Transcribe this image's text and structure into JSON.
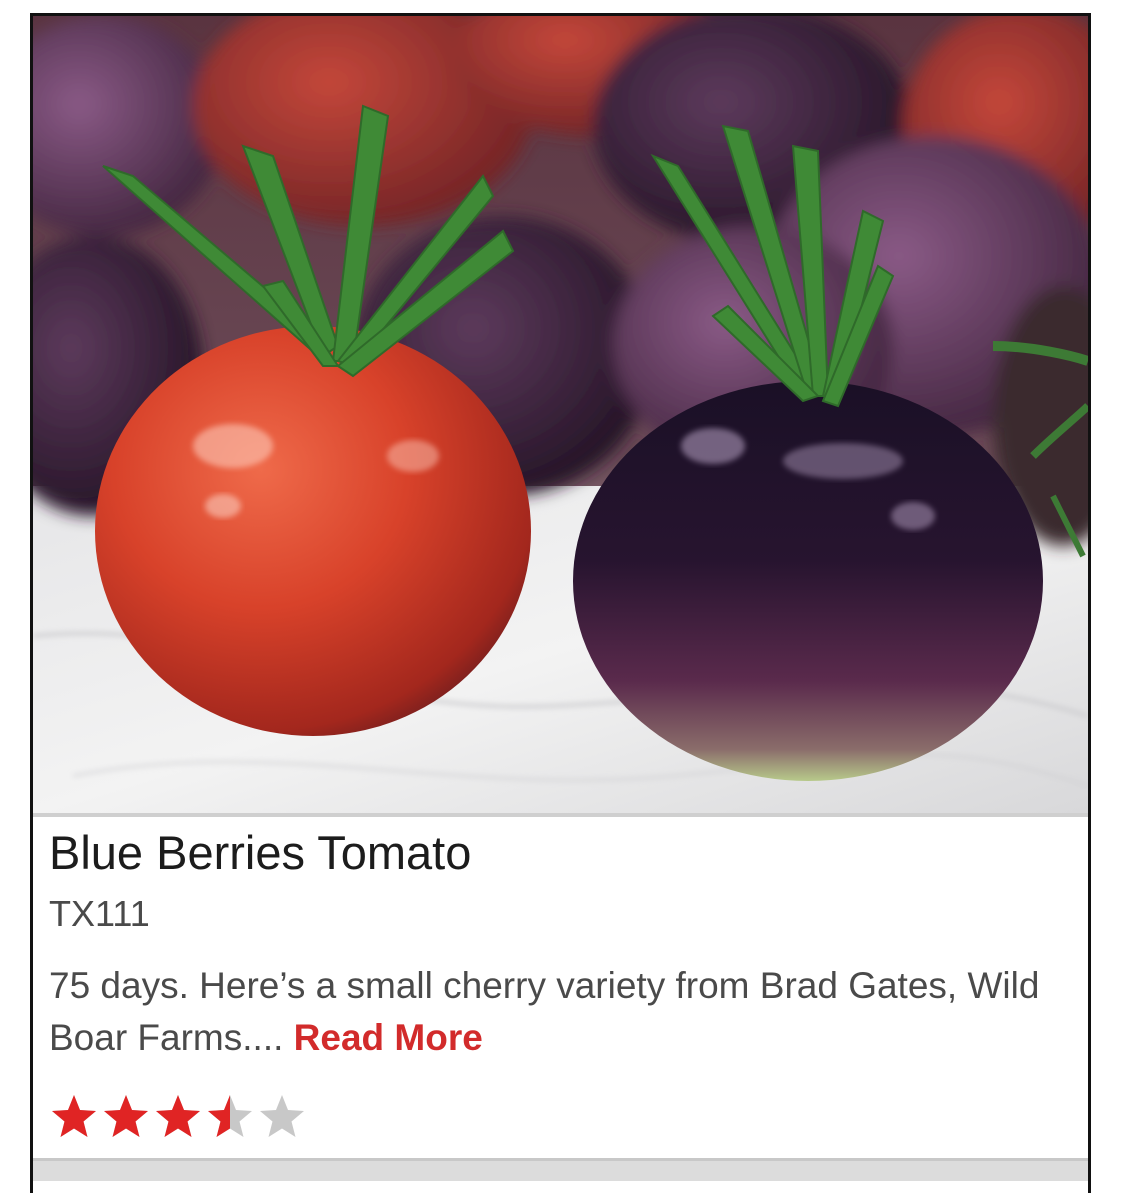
{
  "product": {
    "name": "Blue Berries Tomato",
    "sku": "TX111",
    "description": "75 days. Here’s a small cherry variety from Brad Gates, Wild Boar Farms....",
    "read_more_label": "Read More",
    "image_alt": "Blue Berries Tomato photo",
    "rating": 3.5,
    "rating_max": 5
  },
  "colors": {
    "accent": "#d22b2b",
    "star_filled": "#e02424",
    "star_empty": "#c8c8c8",
    "title_text": "#1c1c1c",
    "body_text": "#4a4a4a"
  },
  "icons": {
    "star_full": "star-icon",
    "star_half": "star-half-icon",
    "star_empty": "star-empty-icon"
  }
}
